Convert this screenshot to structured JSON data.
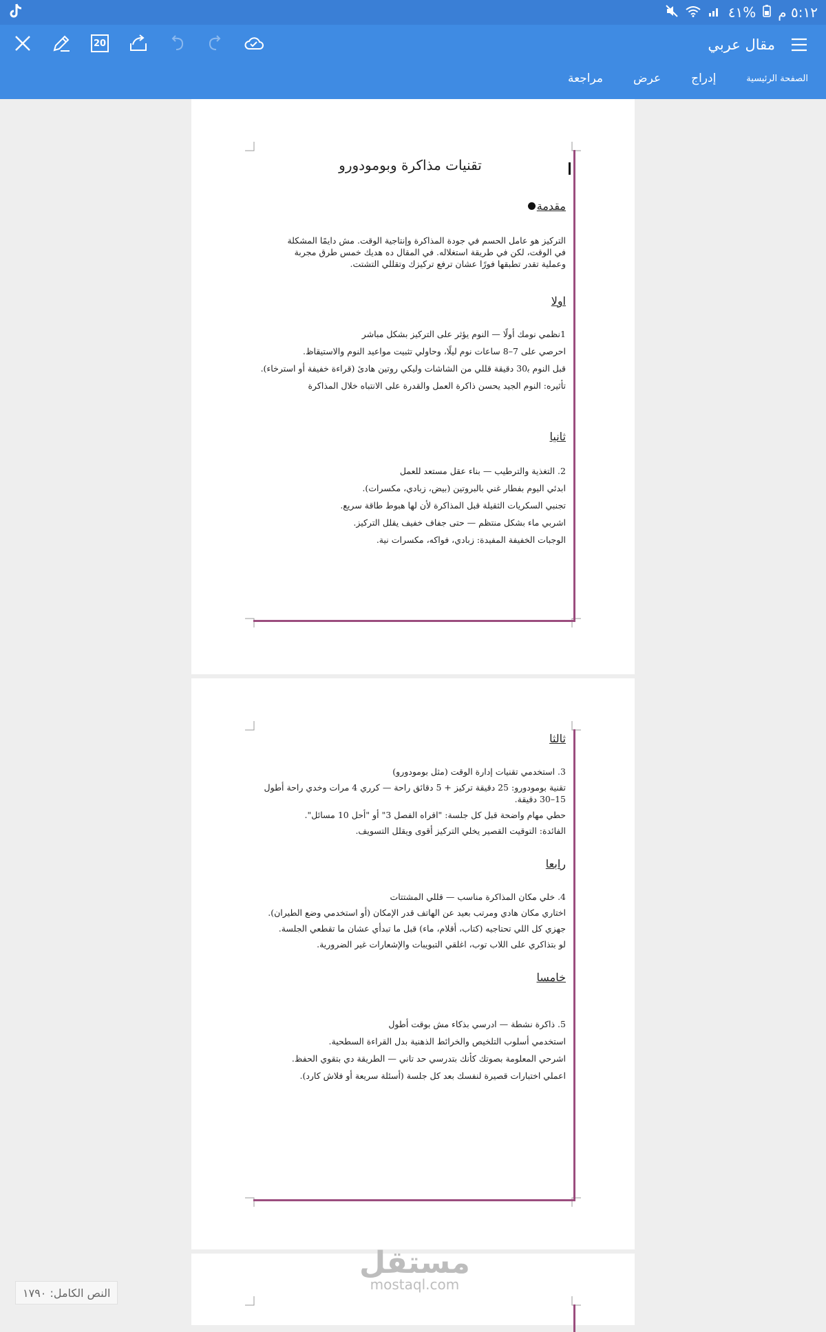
{
  "status": {
    "time": "٥:١٢ م",
    "battery": "%٤١"
  },
  "toolbar": {
    "doc_title": "مقال عربي",
    "page_count": "20"
  },
  "tabs": [
    {
      "label": "الصفحة الرئيسية"
    },
    {
      "label": "إدراج"
    },
    {
      "label": "عرض"
    },
    {
      "label": "مراجعة"
    }
  ],
  "doc": {
    "title": "تقنيات مذاكرة وبومودورو",
    "intro_heading": "مقدمة",
    "intro_lines": [
      "التركيز هو عامل الحسم في جودة المذاكرة وإنتاجية الوقت. مش دايمًا المشكلة",
      "في الوقت، لكن في طريقة استغلاله. في المقال ده هديك خمس طرق مجربة",
      "وعملية تقدر تطبقها فورًا عشان ترفع تركيزك وتقللي التشتت."
    ],
    "sections": [
      {
        "heading": "اولا",
        "lines": [
          "1نظمي نومك أولًا — النوم يؤثر على التركيز بشكل مباشر",
          "احرصي على 7–8 ساعات نوم ليلًا، وحاولي تثبيت مواعيد النوم والاستيقاظ.",
          "قبل النوم ب‍30 دقيقة قللي من الشاشات وليكي روتين هادئ (قراءة خفيفة أو استرخاء).",
          "تأثيره: النوم الجيد يحسن ذاكرة العمل والقدرة على الانتباه خلال المذاكرة"
        ]
      },
      {
        "heading": "ثانيا",
        "lines": [
          "2. التغذية والترطيب — بناء عقل مستعد للعمل",
          "ابدئي اليوم بفطار غني بالبروتين (بيض، زبادي، مكسرات).",
          "تجنبي السكريات الثقيلة قبل المذاكرة لأن لها هبوط طاقة سريع.",
          "اشربي ماء بشكل منتظم — حتى جفاف خفيف يقلل التركيز.",
          "الوجبات الخفيفة المفيدة: زبادي، فواكه، مكسرات نية."
        ]
      },
      {
        "heading": "ثالثا",
        "lines": [
          "3. استخدمي تقنيات إدارة الوقت (مثل بومودورو)",
          "تقنية بومودورو: 25 دقيقة تركيز + 5 دقائق راحة — كرري 4 مرات وخدي راحة أطول 15–30 دقيقة.",
          "حطي مهام واضحة قبل كل جلسة: \"اقراه الفصل 3\" أو \"أحل 10 مسائل\".",
          "الفائدة: التوقيت القصير يخلي التركيز أقوى ويقلل التسويف."
        ]
      },
      {
        "heading": "رابعا",
        "lines": [
          "4. خلي مكان المذاكرة مناسب — قللي المشتتات",
          "اختاري مكان هادي ومرتب بعيد عن الهاتف قدر الإمكان (أو استخدمي وضع الطيران).",
          "جهزي كل اللي تحتاجيه (كتاب، أقلام، ماء) قبل ما تبدأي عشان ما تقطعي الجلسة.",
          "لو بتذاكري على اللاب توب، اغلقي التبويبات والإشعارات غير الضرورية."
        ]
      },
      {
        "heading": "خامسا",
        "lines": [
          "5. ذاكرة نشطة — ادرسي بذكاء مش بوقت أطول",
          "استخدمي أسلوب التلخيص والخرائط الذهنية بدل القراءة السطحية.",
          "اشرحي المعلومة بصوتك كأنك بتدرسي حد تاني — الطريقة دي بتقوي الحفظ.",
          "اعملي اختبارات قصيرة لنفسك بعد كل جلسة (أسئلة سريعة أو فلاش كارد)."
        ]
      }
    ]
  },
  "watermark": {
    "ar": "مستقل",
    "en": "mostaql.com"
  },
  "word_count": "النص الكامل: ١٧٩٠",
  "colors": {
    "toolbar": "#3f8be3",
    "statusbar": "#3a7fd6",
    "page_frame": "#9b4d7e"
  }
}
